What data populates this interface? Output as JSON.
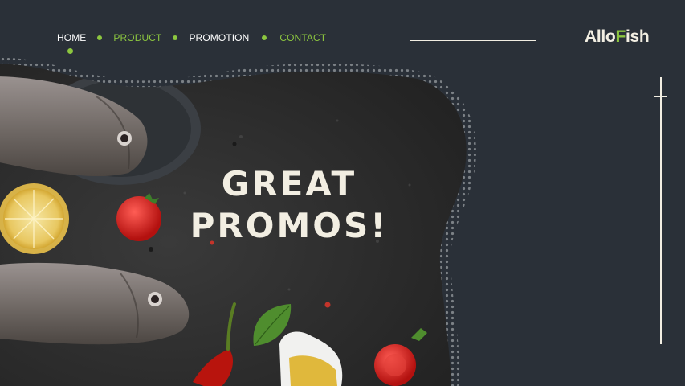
{
  "nav": {
    "items": [
      {
        "label": "HOME",
        "color": "#ffffff"
      },
      {
        "label": "PRODUCT",
        "color": "#8cc63f"
      },
      {
        "label": "PROMOTION",
        "color": "#ffffff"
      },
      {
        "label": "CONTACT",
        "color": "#8cc63f"
      }
    ],
    "active_item": "HOME"
  },
  "brand": {
    "logo_part1": "Allo",
    "logo_accent": "F",
    "logo_part2": "ish"
  },
  "hero": {
    "headline_line1": "GREAT",
    "headline_line2": "PROMOS!"
  },
  "colors": {
    "background": "#2a3038",
    "accent": "#8cc63f",
    "cream": "#f2eee2",
    "slate": "#2c2c2c"
  },
  "icons": [
    "scroll-indicator-icon"
  ]
}
